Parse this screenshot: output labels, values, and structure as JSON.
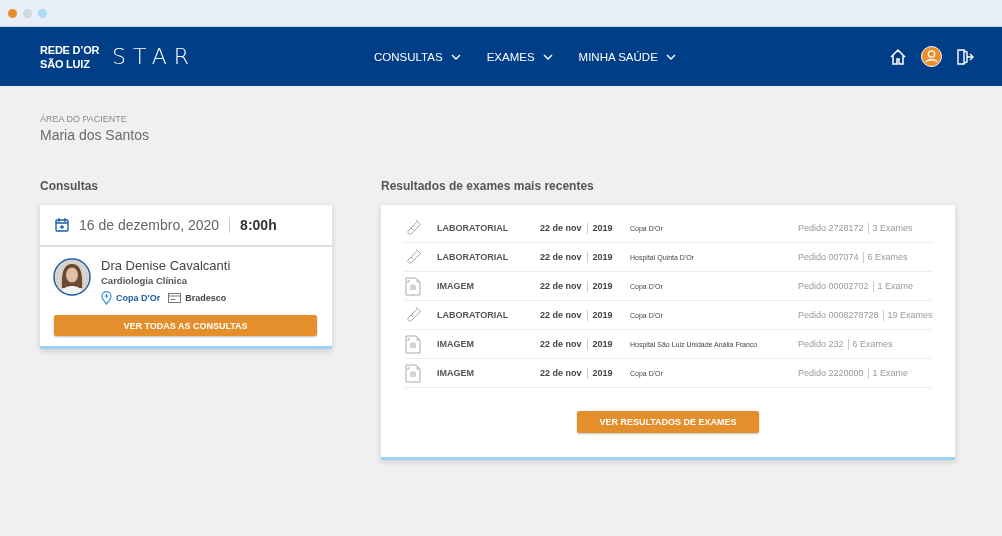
{
  "brand": {
    "line_1": "REDE D’OR",
    "line_2": "SÃO LUIZ",
    "product": "STAR"
  },
  "nav": [
    {
      "label": "CONSULTAS"
    },
    {
      "label": "EXAMES"
    },
    {
      "label": "MINHA SAÚDE"
    }
  ],
  "patient": {
    "caption": "ÁREA DO PACIENTE",
    "name": "Maria dos Santos"
  },
  "consultas": {
    "title": "Consultas",
    "date": "16 de dezembro, 2020",
    "time": "8:00h",
    "doctor": "Dra Denise Cavalcanti",
    "specialty": "Cardiologia Clínica",
    "location": "Copa D'Or",
    "insurance": "Bradesco",
    "button": "VER TODAS AS CONSULTAS"
  },
  "exams": {
    "title": "Resultados de exames mais recentes",
    "rows": [
      {
        "kind": "lab",
        "type": "LABORATORIAL",
        "date": "22 de nov",
        "year": "2019",
        "place": "Copa D'Or",
        "order": "Pedido 2728172",
        "count": "3 Exames"
      },
      {
        "kind": "lab",
        "type": "LABORATORIAL",
        "date": "22 de nov",
        "year": "2019",
        "place": "Hospital Quinta D'Or",
        "order": "Pedido 007074",
        "count": "6 Exames"
      },
      {
        "type": "IMAGEM",
        "date": "22 de nov",
        "year": "2019",
        "place": "Copa D'Or",
        "order": "Pedido 00002702",
        "count": "1 Exame"
      },
      {
        "kind": "lab",
        "type": "LABORATORIAL",
        "date": "22 de nov",
        "year": "2019",
        "place": "Copa D'Or",
        "order": "Pedido 0008278728",
        "count": "19 Exames"
      },
      {
        "type": "IMAGEM",
        "date": "22 de nov",
        "year": "2019",
        "place": "Hospital São Luiz Unidade Anália Franco",
        "order": "Pedido 232",
        "count": "6 Exames"
      },
      {
        "type": "IMAGEM",
        "date": "22 de nov",
        "year": "2019",
        "place": "Copa D'Or",
        "order": "Pedido 2220000",
        "count": "1 Exame"
      }
    ],
    "button": "VER RESULTADOS DE EXAMES"
  }
}
